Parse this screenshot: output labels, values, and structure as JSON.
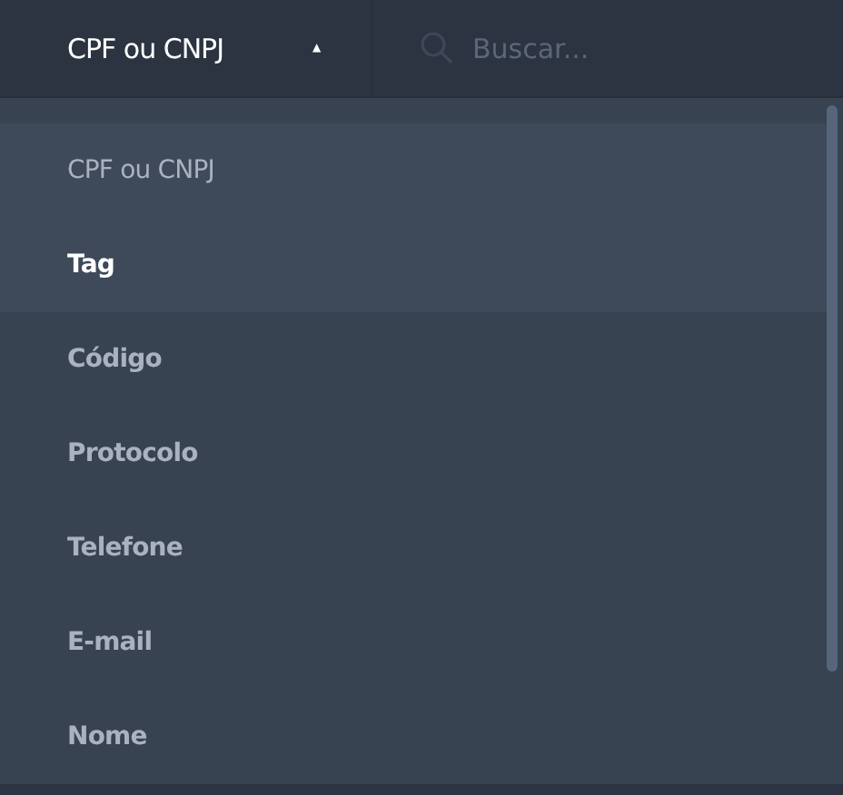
{
  "filter_dropdown": {
    "label": "CPF ou CNPJ",
    "caret": "▲",
    "expanded": true
  },
  "search": {
    "placeholder": "Buscar..."
  },
  "menu": {
    "items": [
      {
        "label": "CPF ou CNPJ",
        "selected": true,
        "focused": false
      },
      {
        "label": "Tag",
        "selected": false,
        "focused": true
      },
      {
        "label": "Código",
        "selected": false,
        "focused": false
      },
      {
        "label": "Protocolo",
        "selected": false,
        "focused": false
      },
      {
        "label": "Telefone",
        "selected": false,
        "focused": false
      },
      {
        "label": "E-mail",
        "selected": false,
        "focused": false
      },
      {
        "label": "Nome",
        "selected": false,
        "focused": false
      }
    ]
  }
}
